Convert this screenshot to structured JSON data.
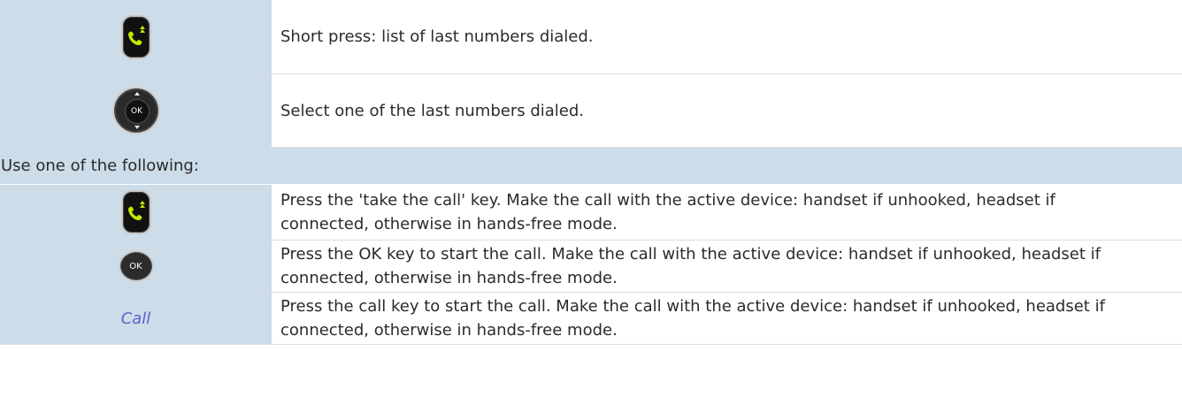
{
  "rows": [
    {
      "icon": "redial-key-icon",
      "text": "Short press: list of last numbers dialed."
    },
    {
      "icon": "navigator-ok-icon",
      "icon_label": "OK",
      "text": "Select one of the last numbers dialed."
    }
  ],
  "section_header": "Use one of the following:",
  "options": [
    {
      "icon": "take-call-key-icon",
      "text": "Press the 'take the call' key. Make the call with the active device: handset if unhooked, headset if connected, otherwise in hands-free mode."
    },
    {
      "icon": "ok-key-icon",
      "icon_label": "OK",
      "text": "Press the OK key to start the call. Make the call with the active device: handset if unhooked, headset if connected, otherwise in hands-free mode."
    },
    {
      "label": "Call",
      "text": "Press the call key to start the call. Make the call with the active device: handset if unhooked, headset if connected, otherwise in hands-free mode."
    }
  ],
  "colors": {
    "left_cell_bg": "#ccdce9",
    "call_link": "#5a62c8",
    "key_green": "#c6e600"
  }
}
